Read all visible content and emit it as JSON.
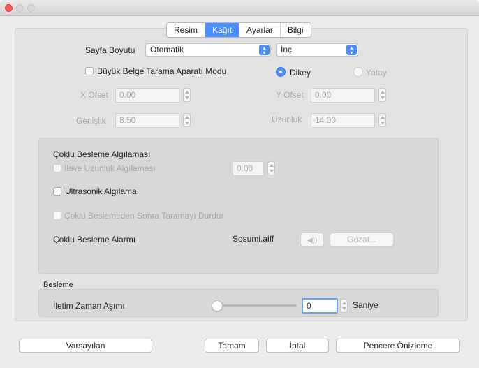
{
  "window": {
    "title": ""
  },
  "tabs": [
    "Resim",
    "Kağıt",
    "Ayarlar",
    "Bilgi"
  ],
  "active_tab": "Kağıt",
  "page_size": {
    "label": "Sayfa Boyutu",
    "value": "Otomatik",
    "unit": "İnç"
  },
  "large_doc": {
    "label": "Büyük Belge Tarama Aparatı Modu",
    "checked": false
  },
  "orientation": {
    "portrait": "Dikey",
    "landscape": "Yatay",
    "selected": "Dikey"
  },
  "x_offset": {
    "label": "X Ofset",
    "value": "0.00"
  },
  "y_offset": {
    "label": "Y Ofset",
    "value": "0.00"
  },
  "width": {
    "label": "Genişlik",
    "value": "8.50"
  },
  "length": {
    "label": "Uzunluk",
    "value": "14.00"
  },
  "multifeed": {
    "title": "Çoklu Besleme Algılaması",
    "extra_length": {
      "label": "İlave Uzunluk Algılaması",
      "value": "0.00",
      "enabled": false
    },
    "ultrasonic": {
      "label": "Ultrasonik Algılama",
      "checked": false
    },
    "stop_scan": {
      "label": "Çoklu Beslemeden Sonra Taramayı Durdur",
      "enabled": false
    },
    "alarm": {
      "label": "Çoklu Besleme Alarmı",
      "sound": "Sosumi.aiff",
      "play_icon": "speaker-icon",
      "browse": "Gözat..."
    }
  },
  "feed": {
    "title": "Besleme",
    "timeout": {
      "label": "İletim Zaman Aşımı",
      "value": "0",
      "unit": "Saniye",
      "slider_fraction": 0.0
    }
  },
  "buttons": {
    "defaults": "Varsayılan",
    "ok": "Tamam",
    "cancel": "İptal",
    "preview": "Pencere Önizleme"
  },
  "colors": {
    "accent": "#4a8dfc",
    "close": "#fc5753"
  }
}
